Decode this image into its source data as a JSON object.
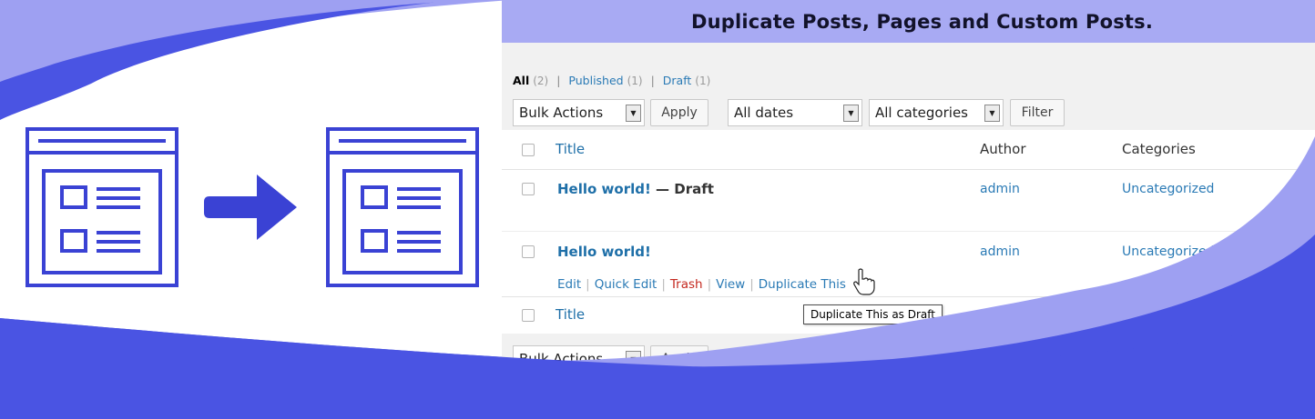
{
  "banner": {
    "title": "Duplicate Posts, Pages and Custom Posts."
  },
  "colors": {
    "banner_bg": "#a8aaf3",
    "wave_dark": "#4a54e3",
    "wave_light": "#9ea0f2",
    "icon_blue": "#3a42d4",
    "link_blue": "#1e6fa8",
    "trash_red": "#c4281f"
  },
  "icons": {
    "left_window": "window-layout-icon",
    "arrow": "arrow-right-icon",
    "right_window": "window-layout-icon",
    "cursor": "hand-pointer-icon"
  },
  "filters": {
    "all_label": "All",
    "all_count": "(2)",
    "published_label": "Published",
    "published_count": "(1)",
    "draft_label": "Draft",
    "draft_count": "(1)",
    "separator": "|"
  },
  "toolbar": {
    "bulk_actions": "Bulk Actions",
    "apply": "Apply",
    "dates": "All dates",
    "categories": "All categories",
    "filter": "Filter",
    "dropdown_arrow": "▼"
  },
  "table": {
    "headers": {
      "title": "Title",
      "author": "Author",
      "categories": "Categories"
    },
    "rows": [
      {
        "title": "Hello world!",
        "state": " — Draft",
        "author": "admin",
        "category": "Uncategorized"
      },
      {
        "title": "Hello world!",
        "state": "",
        "author": "admin",
        "category": "Uncategorized"
      }
    ],
    "row_actions": [
      {
        "label": "Edit"
      },
      {
        "label": "Quick Edit"
      },
      {
        "label": "Trash"
      },
      {
        "label": "View"
      },
      {
        "label": "Duplicate This"
      }
    ],
    "action_separator": "|"
  },
  "tooltip": {
    "text": "Duplicate This as Draft"
  }
}
